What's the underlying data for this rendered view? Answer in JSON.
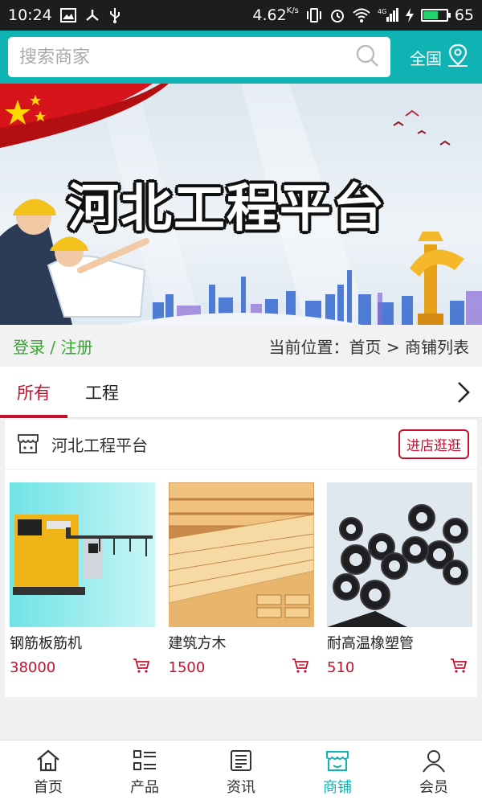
{
  "status_bar": {
    "time": "10:24",
    "speed": "4.62",
    "speed_unit": "K/s",
    "network": "4G",
    "battery": "65",
    "battery_fraction": 0.65,
    "icons": [
      "image-icon",
      "share-icon",
      "usb-icon",
      "vibrate-icon",
      "alarm-icon",
      "wifi-icon",
      "signal-icon",
      "charging-icon",
      "battery-icon"
    ]
  },
  "search": {
    "placeholder": "搜索商家",
    "region_label": "全国"
  },
  "banner": {
    "title": "河北工程平台"
  },
  "breadcrumb": {
    "login": "登录",
    "separator": "/",
    "register": "注册",
    "location_prefix": "当前位置：",
    "home": "首页",
    "arrow": ">",
    "current": "商铺列表"
  },
  "tabs": [
    {
      "label": "所有",
      "active": true
    },
    {
      "label": "工程",
      "active": false
    }
  ],
  "shop": {
    "name": "河北工程平台",
    "visit_label": "进店逛逛",
    "products": [
      {
        "name": "钢筋板筋机",
        "price": "38000"
      },
      {
        "name": "建筑方木",
        "price": "1500"
      },
      {
        "name": "耐高温橡塑管",
        "price": "510"
      }
    ]
  },
  "bottom_nav": [
    {
      "label": "首页",
      "icon": "home-icon",
      "active": false
    },
    {
      "label": "产品",
      "icon": "list-icon",
      "active": false
    },
    {
      "label": "资讯",
      "icon": "news-icon",
      "active": false
    },
    {
      "label": "商铺",
      "icon": "store-icon",
      "active": true
    },
    {
      "label": "会员",
      "icon": "user-icon",
      "active": false
    }
  ],
  "colors": {
    "primary": "#10b3b3",
    "accent_red": "#c8102e",
    "login_green": "#3aa335",
    "status_bar": "#1d1d1d"
  }
}
